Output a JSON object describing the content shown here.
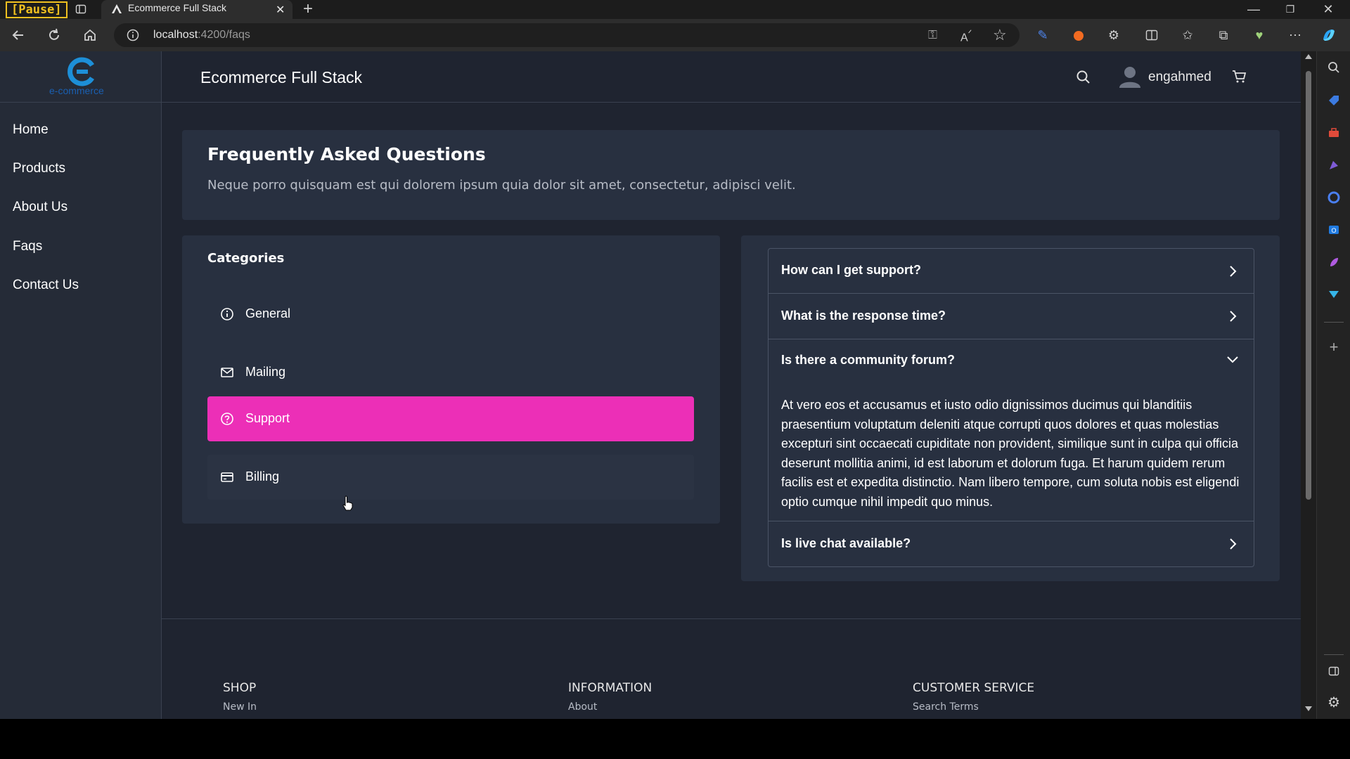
{
  "browser": {
    "pause_label": "[Pause]",
    "tab_title": "Ecommerce Full Stack",
    "url_host": "localhost",
    "url_path": ":4200/faqs"
  },
  "app": {
    "logo_text": "e-commerce",
    "title": "Ecommerce Full Stack",
    "username": "engahmed"
  },
  "sidebar": {
    "items": [
      {
        "label": "Home"
      },
      {
        "label": "Products"
      },
      {
        "label": "About Us"
      },
      {
        "label": "Faqs"
      },
      {
        "label": "Contact Us"
      }
    ]
  },
  "faq_header": {
    "title": "Frequently Asked Questions",
    "subtitle": "Neque porro quisquam est qui dolorem ipsum quia dolor sit amet, consectetur, adipisci velit."
  },
  "categories": {
    "title": "Categories",
    "items": [
      {
        "label": "General",
        "icon": "info-icon"
      },
      {
        "label": "Mailing",
        "icon": "mail-icon"
      },
      {
        "label": "Support",
        "icon": "help-icon",
        "active": true
      },
      {
        "label": "Billing",
        "icon": "credit-card-icon"
      }
    ]
  },
  "accordion": {
    "items": [
      {
        "question": "How can I get support?"
      },
      {
        "question": "What is the response time?"
      },
      {
        "question": "Is there a community forum?",
        "expanded": true,
        "answer": "At vero eos et accusamus et iusto odio dignissimos ducimus qui blanditiis praesentium voluptatum deleniti atque corrupti quos dolores et quas molestias excepturi sint occaecati cupiditate non provident, similique sunt in culpa qui officia deserunt mollitia animi, id est laborum et dolorum fuga. Et harum quidem rerum facilis est et expedita distinctio. Nam libero tempore, cum soluta nobis est eligendi optio cumque nihil impedit quo minus."
      },
      {
        "question": "Is live chat available?"
      }
    ]
  },
  "footer": {
    "columns": [
      {
        "heading": "SHOP",
        "link": "New In"
      },
      {
        "heading": "INFORMATION",
        "link": "About"
      },
      {
        "heading": "CUSTOMER SERVICE",
        "link": "Search Terms"
      }
    ]
  },
  "colors": {
    "accent": "#ec2fb7",
    "page_bg": "#1f2430",
    "panel_bg": "#283040"
  }
}
